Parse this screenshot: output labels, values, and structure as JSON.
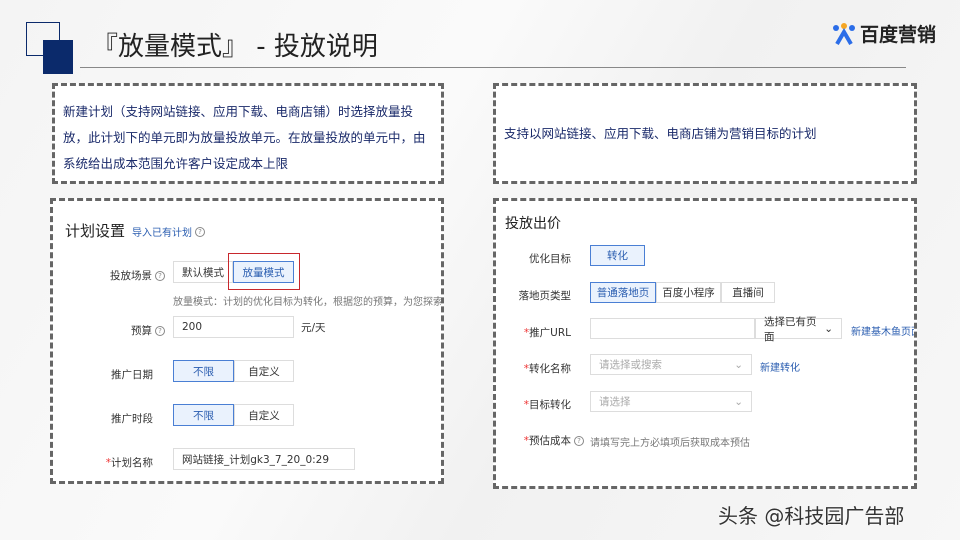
{
  "header": {
    "title": "『放量模式』 - 投放说明",
    "logo_text": "百度营销"
  },
  "notes": {
    "left": "新建计划（支持网站链接、应用下载、电商店铺）时选择放量投放，此计划下的单元即为放量投放单元。在放量投放的单元中，由系统给出成本范围允许客户设定成本上限",
    "right": "支持以网站链接、应用下载、电商店铺为营销目标的计划"
  },
  "plan": {
    "title": "计划设置",
    "import_link": "导入已有计划",
    "scene_label": "投放场景",
    "scene_options": [
      "默认模式",
      "放量模式"
    ],
    "scene_hint": "放量模式：计划的优化目标为转化，根据您的预算，为您探索尽",
    "budget_label": "预算",
    "budget_value": "200",
    "budget_unit": "元/天",
    "date_label": "推广日期",
    "date_options": [
      "不限",
      "自定义"
    ],
    "time_label": "推广时段",
    "time_options": [
      "不限",
      "自定义"
    ],
    "name_label": "计划名称",
    "name_value": "网站链接_计划gk3_7_20_0:29"
  },
  "bid": {
    "title": "投放出价",
    "goal_label": "优化目标",
    "goal_value": "转化",
    "landing_label": "落地页类型",
    "landing_options": [
      "普通落地页",
      "百度小程序",
      "直播间"
    ],
    "url_label": "推广URL",
    "url_select": "选择已有页面",
    "url_link": "新建基木鱼页面",
    "conv_label": "转化名称",
    "conv_placeholder": "请选择或搜索",
    "conv_link": "新建转化",
    "target_label": "目标转化",
    "target_placeholder": "请选择",
    "cost_label": "预估成本",
    "cost_hint": "请填写完上方必填项后获取成本预估"
  },
  "watermark": "头条 @科技园广告部"
}
